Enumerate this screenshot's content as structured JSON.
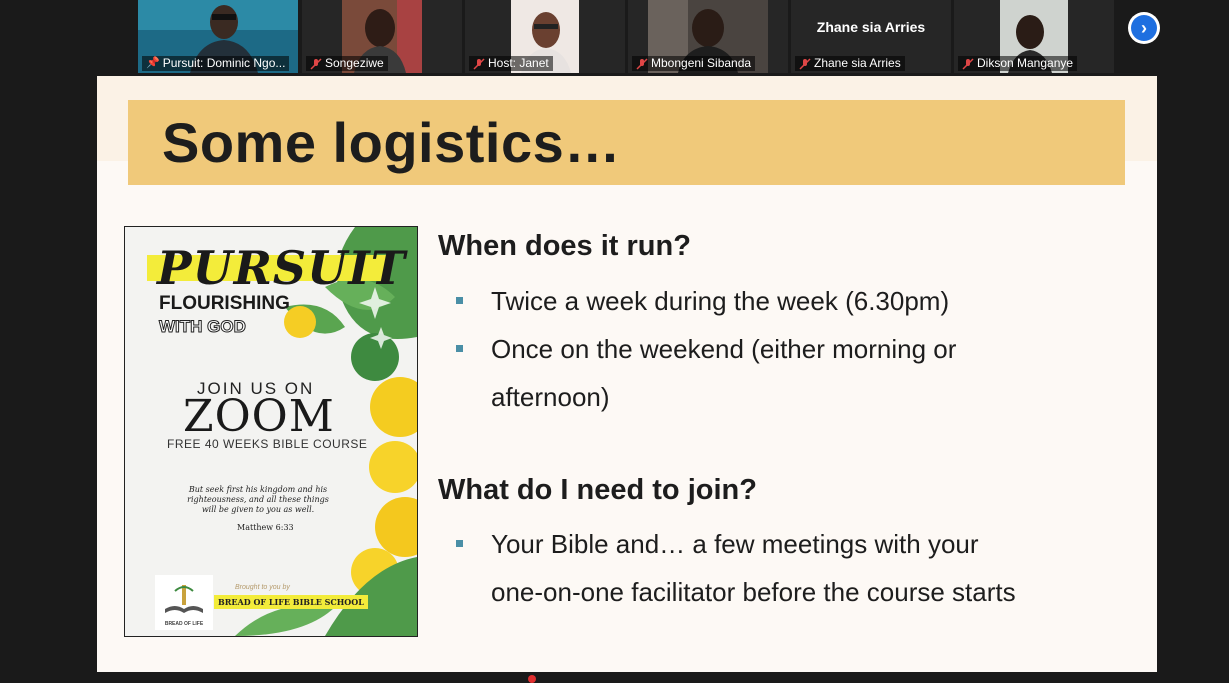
{
  "participants": [
    {
      "name": "Pursuit: Dominic Ngo...",
      "pinned": true,
      "muted": false,
      "video": true,
      "active": true,
      "bg": "#1d6a86"
    },
    {
      "name": "Songeziwe",
      "pinned": false,
      "muted": true,
      "video": true,
      "active": false,
      "bg": "#4a2a2a"
    },
    {
      "name": "Host: Janet",
      "pinned": false,
      "muted": true,
      "video": true,
      "active": false,
      "bg": "#5a4a42"
    },
    {
      "name": "Mbongeni Sibanda",
      "pinned": false,
      "muted": true,
      "video": true,
      "active": false,
      "bg": "#3a3330"
    },
    {
      "name": "Zhane sia Arries",
      "pinned": false,
      "muted": true,
      "video": false,
      "active": false,
      "bg": "#262626"
    },
    {
      "name": "Dikson Manganye",
      "pinned": false,
      "muted": true,
      "video": true,
      "active": false,
      "bg": "#cfd3cf"
    }
  ],
  "no_video_label": "Zhane sia Arries",
  "next_icon": "chevron-right-icon",
  "slide": {
    "title": "Some logistics…",
    "section1": {
      "heading": "When does it run?",
      "bullets": [
        "Twice a week during the week (6.30pm)",
        "Once on the weekend (either morning or",
        "afternoon)"
      ]
    },
    "section2": {
      "heading": "What do I need to join?",
      "bullets": [
        "Your Bible and… a few meetings with your",
        "one-on-one facilitator before the course starts"
      ]
    },
    "poster": {
      "pursuit": "PURSUIT",
      "flourishing": "FLOURISHING",
      "with_god": "WITH GOD",
      "join_us": "JOIN US ON",
      "zoom": "ZOOM",
      "free_course": "FREE 40 WEEKS BIBLE COURSE",
      "verse": "But seek first his kingdom and his righteousness, and all these things will be given to you as well.",
      "verse_ref": "Matthew 6:33",
      "brought_by": "Brought to you by",
      "school": "BREAD OF LIFE BIBLE SCHOOL",
      "logo_text": "BREAD OF LIFE"
    }
  },
  "colors": {
    "title_band": "#f0c97a",
    "bullet": "#4a8fa6",
    "active_tile": "#93c82f",
    "next_button": "#1e6fe0"
  }
}
